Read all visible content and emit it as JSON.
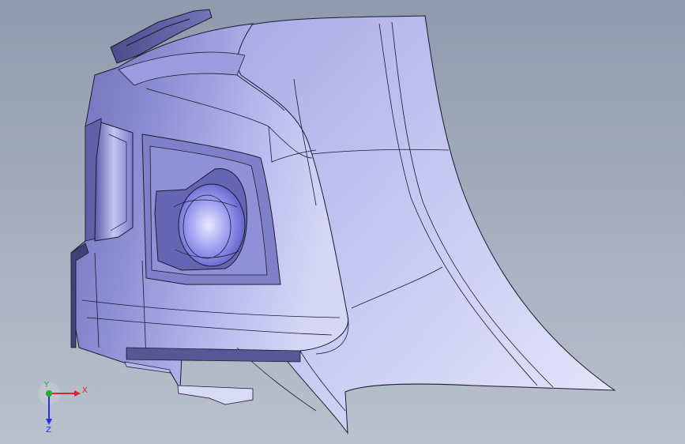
{
  "viewport": {
    "background_top": "#8f9bad",
    "background_bottom": "#b9c1cd",
    "part_color": "#8c8ed6",
    "edge_color": "#1a1a2e"
  },
  "triad": {
    "x_label": "X",
    "y_label": "Y",
    "z_label": "Z",
    "x_color": "#e0242b",
    "y_color": "#1fae2a",
    "z_color": "#2b2fd6"
  }
}
